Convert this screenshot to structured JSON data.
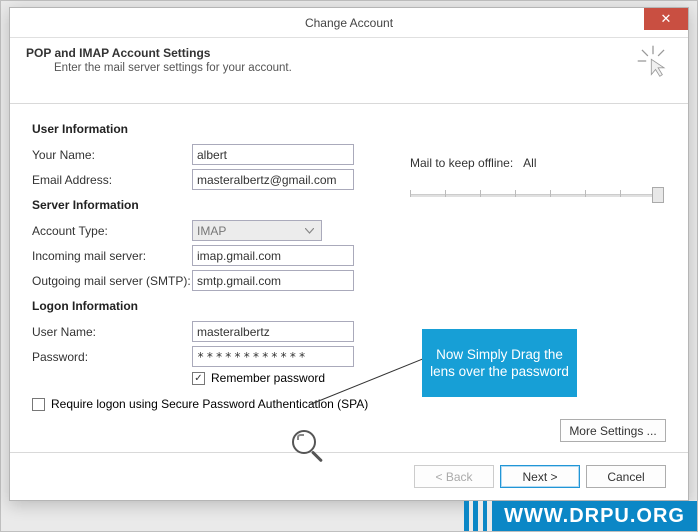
{
  "watermark": "WWW.DRPU.ORG",
  "dialog": {
    "title": "Change Account",
    "close_glyph": "✕"
  },
  "header": {
    "title": "POP and IMAP Account Settings",
    "subtitle": "Enter the mail server settings for your account."
  },
  "sections": {
    "user_info": "User Information",
    "server_info": "Server Information",
    "logon_info": "Logon Information"
  },
  "fields": {
    "your_name": {
      "label": "Your Name:",
      "value": "albert"
    },
    "email": {
      "label": "Email Address:",
      "value": "masteralbertz@gmail.com"
    },
    "account_type": {
      "label": "Account Type:",
      "value": "IMAP"
    },
    "incoming": {
      "label": "Incoming mail server:",
      "value": "imap.gmail.com"
    },
    "outgoing": {
      "label": "Outgoing mail server (SMTP):",
      "value": "smtp.gmail.com"
    },
    "username": {
      "label": "User Name:",
      "value": "masteralbertz"
    },
    "password": {
      "label": "Password:",
      "value": "************"
    },
    "remember": {
      "label": "Remember password",
      "checkmark": "✓"
    },
    "spa": {
      "label": "Require logon using Secure Password Authentication (SPA)"
    }
  },
  "right": {
    "mail_keep_label": "Mail to keep offline:",
    "mail_keep_value": "All"
  },
  "buttons": {
    "more": "More Settings ...",
    "back": "< Back",
    "next": "Next >",
    "cancel": "Cancel"
  },
  "callout": {
    "text": "Now Simply Drag the lens over the password"
  }
}
